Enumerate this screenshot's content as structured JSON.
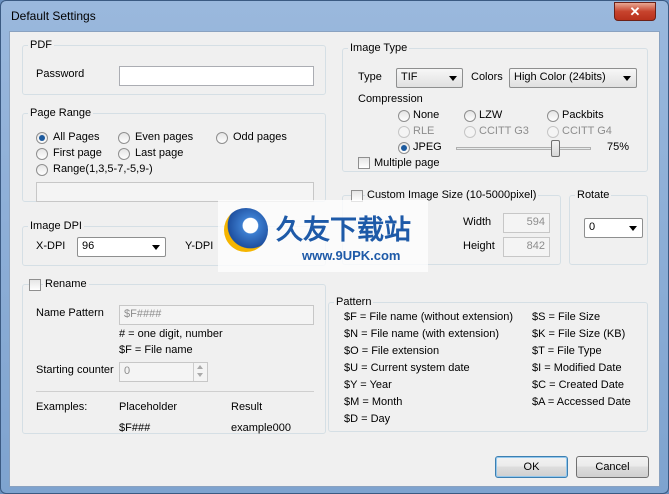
{
  "window": {
    "title": "Default Settings",
    "close_label": "✕"
  },
  "pdf": {
    "label": "PDF",
    "password_label": "Password",
    "password_value": ""
  },
  "page_range": {
    "label": "Page Range",
    "all_pages": "All Pages",
    "even_pages": "Even pages",
    "odd_pages": "Odd pages",
    "first_page": "First page",
    "last_page": "Last page",
    "range": "Range(1,3,5-7,-5,9-)",
    "range_value": ""
  },
  "image_dpi": {
    "label": "Image DPI",
    "xdpi_label": "X-DPI",
    "xdpi_value": "96",
    "ydpi_label": "Y-DPI"
  },
  "image_type": {
    "label": "Image Type",
    "type_label": "Type",
    "type_value": "TIF",
    "colors_label": "Colors",
    "colors_value": "High Color (24bits)",
    "compression_label": "Compression",
    "none": "None",
    "lzw": "LZW",
    "packbits": "Packbits",
    "rle": "RLE",
    "ccitt_g3": "CCITT G3",
    "ccitt_g4": "CCITT G4",
    "jpeg": "JPEG",
    "quality": "75%",
    "quality_level": 0.75,
    "multiple_page": "Multiple page"
  },
  "custom_size": {
    "label": "Custom Image Size (10-5000pixel)",
    "width_label": "Width",
    "width_value": "594",
    "height_label": "Height",
    "height_value": "842"
  },
  "rotate": {
    "label": "Rotate",
    "value": "0"
  },
  "rename": {
    "label": "Rename",
    "name_pattern_label": "Name Pattern",
    "name_pattern_value": "$F####",
    "hint1": "# = one digit, number",
    "hint2": "$F = File name",
    "starting_counter_label": "Starting counter",
    "starting_counter_value": "0",
    "examples_label": "Examples:",
    "placeholder_label": "Placeholder",
    "result_label": "Result",
    "example_placeholder": "$F###",
    "example_result": "example000"
  },
  "pattern": {
    "label": "Pattern",
    "left": [
      "$F = File name (without extension)",
      "$N = File name (with extension)",
      "$O = File extension",
      "$U = Current system date",
      "$Y = Year",
      "$M = Month",
      "$D = Day"
    ],
    "right": [
      "$S = File Size",
      "$K = File Size (KB)",
      "$T = File Type",
      "$I = Modified Date",
      "$C = Created Date",
      "$A = Accessed Date"
    ]
  },
  "buttons": {
    "ok": "OK",
    "cancel": "Cancel"
  },
  "watermark": {
    "text": "久友下载站",
    "url": "www.9UPK.com"
  }
}
